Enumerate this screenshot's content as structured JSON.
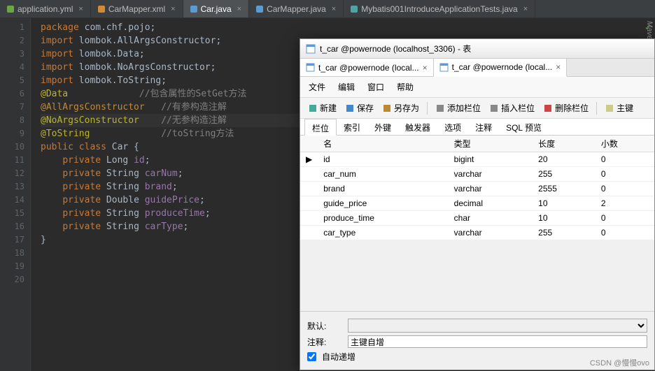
{
  "ide_tabs": [
    {
      "icon": "green",
      "label": "application.yml",
      "active": false
    },
    {
      "icon": "orange",
      "label": "CarMapper.xml",
      "active": false
    },
    {
      "icon": "blue",
      "label": "Car.java",
      "active": true
    },
    {
      "icon": "blue",
      "label": "CarMapper.java",
      "active": false
    },
    {
      "icon": "teal",
      "label": "Mybatis001IntroduceApplicationTests.java",
      "active": false
    }
  ],
  "code": {
    "package_kw": "package",
    "package": "com.chf.pojo",
    "import_kw": "import",
    "imports": [
      "lombok.AllArgsConstructor",
      "lombok.Data",
      "lombok.NoArgsConstructor",
      "lombok.ToString"
    ],
    "ann": {
      "data": "@Data",
      "all": "@AllArgsConstructor",
      "no": "@NoArgsConstructor",
      "ts": "@ToString"
    },
    "cmt": {
      "data": "//包含属性的SetGet方法",
      "all": "//有参构造注解",
      "no": "//无参构造注解",
      "ts": "//toString方法"
    },
    "cls_decl_kw": "public class",
    "cls_name": "Car",
    "fields": [
      {
        "mod": "private",
        "type": "Long",
        "name": "id"
      },
      {
        "mod": "private",
        "type": "String",
        "name": "carNum"
      },
      {
        "mod": "private",
        "type": "String",
        "name": "brand"
      },
      {
        "mod": "private",
        "type": "Double",
        "name": "guidePrice"
      },
      {
        "mod": "private",
        "type": "String",
        "name": "produceTime"
      },
      {
        "mod": "private",
        "type": "String",
        "name": "carType"
      }
    ]
  },
  "db": {
    "title": "t_car @powernode (localhost_3306) - 表",
    "tabs": [
      {
        "label": "t_car @powernode (local...",
        "active": false
      },
      {
        "label": "t_car @powernode (local...",
        "active": true
      }
    ],
    "menu": [
      "文件",
      "编辑",
      "窗口",
      "帮助"
    ],
    "tools": [
      "新建",
      "保存",
      "另存为",
      "添加栏位",
      "插入栏位",
      "删除栏位",
      "主键"
    ],
    "sub_tabs": [
      "栏位",
      "索引",
      "外键",
      "触发器",
      "选项",
      "注释",
      "SQL 预览"
    ],
    "cols": [
      "名",
      "类型",
      "长度",
      "小数"
    ],
    "rows": [
      {
        "name": "id",
        "type": "bigint",
        "len": "20",
        "dec": "0",
        "ptr": true
      },
      {
        "name": "car_num",
        "type": "varchar",
        "len": "255",
        "dec": "0"
      },
      {
        "name": "brand",
        "type": "varchar",
        "len": "2555",
        "dec": "0"
      },
      {
        "name": "guide_price",
        "type": "decimal",
        "len": "10",
        "dec": "2"
      },
      {
        "name": "produce_time",
        "type": "char",
        "len": "10",
        "dec": "0"
      },
      {
        "name": "car_type",
        "type": "varchar",
        "len": "255",
        "dec": "0"
      }
    ],
    "form": {
      "default": "默认:",
      "comment": "注释:",
      "comment_val": "主键自增",
      "auto": "自动递增"
    }
  },
  "maven": "Maven",
  "watermark": "CSDN @慢慢ovo"
}
